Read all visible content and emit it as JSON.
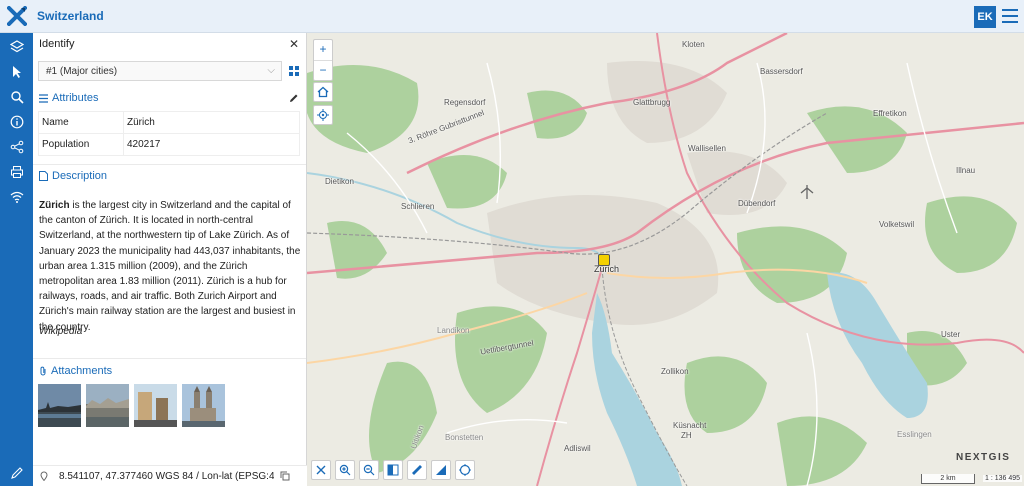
{
  "header": {
    "title": "Switzerland",
    "avatar_initials": "EK"
  },
  "rail": {
    "items": [
      "layers-icon",
      "identify-cursor-icon",
      "search-icon",
      "info-icon",
      "share-icon",
      "print-icon",
      "wifi-icon"
    ],
    "bottom": "pencil-icon"
  },
  "panel": {
    "title": "Identify",
    "layer_select": "#1 (Major cities)",
    "attributes_heading": "Attributes",
    "attributes": [
      {
        "key": "Name",
        "value": "Zürich"
      },
      {
        "key": "Population",
        "value": "420217"
      }
    ],
    "description_heading": "Description",
    "description_bold": "Zürich",
    "description_text": " is the largest city in Switzerland and the capital of the canton of Zürich. It is located in north-central Switzerland, at the northwestern tip of Lake Zürich. As of January 2023 the municipality had 443,037 inhabitants, the urban area 1.315 million (2009), and the Zürich metropolitan area 1.83 million (2011). Zürich is a hub for railways, roads, and air traffic. Both Zurich Airport and Zürich's main railway station are the largest and busiest in the country.",
    "source": "Wikipedia",
    "attachments_heading": "Attachments",
    "attachment_count": 4
  },
  "coordinates": {
    "text": "8.541107, 47.377460 WGS 84 / Lon-lat (EPSG:432..."
  },
  "map": {
    "labels": {
      "kloten": "Kloten",
      "bassersdorf": "Bassersdorf",
      "regensdorf": "Regensdorf",
      "glattbrugg": "Glattbrugg",
      "effretikon": "Effretikon",
      "tunnel": "3. Röhre Gubristtunnel",
      "wallisellen": "Wallisellen",
      "dietikon": "Dietikon",
      "illnau": "Illnau",
      "schlieren": "Schlieren",
      "dubendorf": "Dübendorf",
      "volketswil": "Volketswil",
      "zurich": "Zürich",
      "uster": "Uster",
      "uetliberg": "Uetlibergtunnel",
      "zollikon": "Zollikon",
      "kusnacht": "Küsnacht",
      "zh": "ZH",
      "adliswil": "Adliswil",
      "uitikon": "Uitikon",
      "landikon": "Landikon",
      "bonstetten": "Bonstetten",
      "esslingen": "Esslingen"
    },
    "brand": "NEXTGIS",
    "scale_bar": "2 km",
    "scale_ratio": "1 : 136 495"
  },
  "colors": {
    "accent": "#1a6bb8",
    "water": "#aad3df",
    "forest": "#add19e",
    "urban": "#e0dcd4"
  }
}
